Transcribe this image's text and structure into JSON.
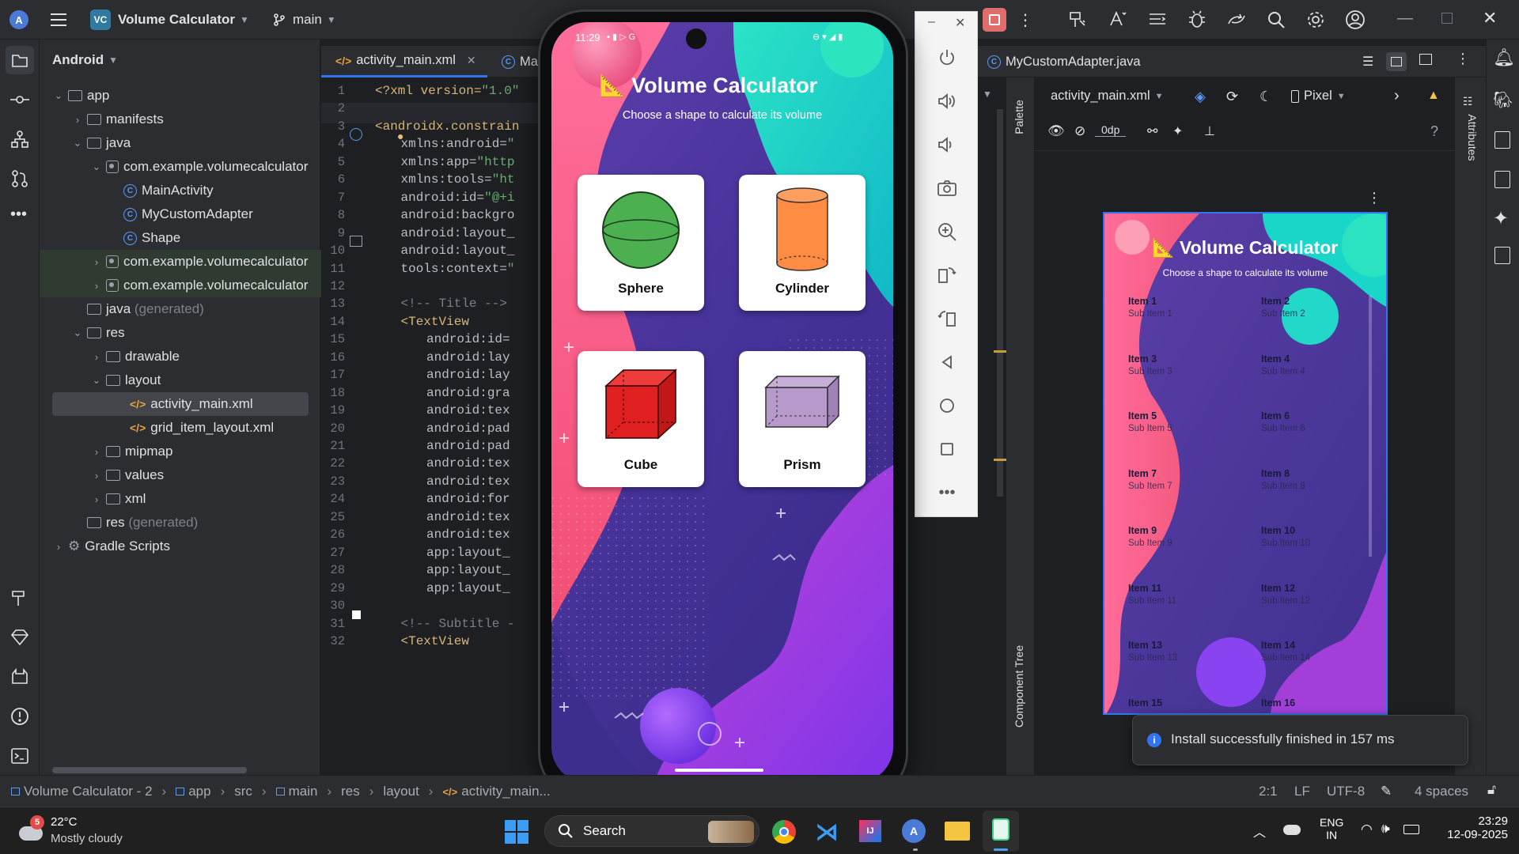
{
  "titlebar": {
    "app_icon_label": "A",
    "project_badge": "VC",
    "project_name": "Volume Calculator",
    "branch": "main"
  },
  "project_panel": {
    "view_selector": "Android",
    "tree": [
      {
        "label": "app"
      },
      {
        "label": "manifests"
      },
      {
        "label": "java"
      },
      {
        "label": "com.example.volumecalculator"
      },
      {
        "label": "MainActivity"
      },
      {
        "label": "MyCustomAdapter"
      },
      {
        "label": "Shape"
      },
      {
        "label": "com.example.volumecalculator"
      },
      {
        "label": "com.example.volumecalculator"
      },
      {
        "label": "java",
        "suffix": "(generated)"
      },
      {
        "label": "res"
      },
      {
        "label": "drawable"
      },
      {
        "label": "layout"
      },
      {
        "label": "activity_main.xml"
      },
      {
        "label": "grid_item_layout.xml"
      },
      {
        "label": "mipmap"
      },
      {
        "label": "values"
      },
      {
        "label": "xml"
      },
      {
        "label": "res",
        "suffix": "(generated)"
      },
      {
        "label": "Gradle Scripts"
      }
    ]
  },
  "editor": {
    "tabs": [
      {
        "label": "activity_main.xml",
        "active": true
      },
      {
        "label": "Ma"
      },
      {
        "label": "MyCustomAdapter.java"
      }
    ],
    "line_numbers": [
      "1",
      "2",
      "3",
      "4",
      "5",
      "6",
      "7",
      "8",
      "9",
      "10",
      "11",
      "12",
      "13",
      "14",
      "15",
      "16",
      "17",
      "18",
      "19",
      "20",
      "21",
      "22",
      "23",
      "24",
      "25",
      "26",
      "27",
      "28",
      "29",
      "30",
      "31",
      "32"
    ],
    "lines": {
      "l1_a": "<?xml version=",
      "l1_b": "\"1.0\"",
      "l3": "<androidx.constrain",
      "l4_a": "xmlns:android=",
      "l4_b": "\"",
      "l5_a": "xmlns:app=",
      "l5_b": "\"http",
      "l6_a": "xmlns:tools=",
      "l6_b": "\"ht",
      "l7_a": "android:id=",
      "l7_b": "\"@+i",
      "l8": "android:backgro",
      "l9": "android:layout_",
      "l10": "android:layout_",
      "l11_a": "tools:context=",
      "l11_b": "\"",
      "l13": "<!-- Title -->",
      "l14": "<TextView",
      "l15": "android:id=",
      "l16": "android:lay",
      "l17": "android:lay",
      "l18": "android:gra",
      "l19": "android:tex",
      "l20": "android:pad",
      "l21": "android:pad",
      "l22": "android:tex",
      "l23": "android:tex",
      "l24": "android:for",
      "l25": "android:tex",
      "l26": "android:tex",
      "l27": "app:layout_",
      "l28": "app:layout_",
      "l29": "app:layout_",
      "l31": "<!-- Subtitle -",
      "l32": "<TextView"
    }
  },
  "phone": {
    "status_time": "11:29",
    "title": "Volume Calculator",
    "subtitle": "Choose a shape to calculate its volume",
    "cards": [
      {
        "label": "Sphere"
      },
      {
        "label": "Cylinder"
      },
      {
        "label": "Cube"
      },
      {
        "label": "Prism"
      }
    ]
  },
  "design": {
    "file_selector": "activity_main.xml",
    "device": "Pixel",
    "margin_value": "0dp",
    "palette_label": "Palette",
    "attributes_label": "Attributes",
    "component_tree_label": "Component Tree",
    "preview_title": "Volume Calculator",
    "preview_subtitle": "Choose a shape to calculate its volume",
    "preview_items": [
      {
        "title": "Item 1",
        "sub": "Sub Item 1"
      },
      {
        "title": "Item 2",
        "sub": "Sub Item 2"
      },
      {
        "title": "Item 3",
        "sub": "Sub Item 3"
      },
      {
        "title": "Item 4",
        "sub": "Sub Item 4"
      },
      {
        "title": "Item 5",
        "sub": "Sub Item 5"
      },
      {
        "title": "Item 6",
        "sub": "Sub Item 6"
      },
      {
        "title": "Item 7",
        "sub": "Sub Item 7"
      },
      {
        "title": "Item 8",
        "sub": "Sub Item 8"
      },
      {
        "title": "Item 9",
        "sub": "Sub Item 9"
      },
      {
        "title": "Item 10",
        "sub": "Sub Item 10"
      },
      {
        "title": "Item 11",
        "sub": "Sub Item 11"
      },
      {
        "title": "Item 12",
        "sub": "Sub Item 12"
      },
      {
        "title": "Item 13",
        "sub": "Sub Item 13"
      },
      {
        "title": "Item 14",
        "sub": "Sub Item 14"
      },
      {
        "title": "Item 15",
        "sub": ""
      },
      {
        "title": "Item 16",
        "sub": ""
      }
    ]
  },
  "toast": {
    "message": "Install successfully finished in 157 ms"
  },
  "statusbar": {
    "breadcrumb": [
      "Volume Calculator - 2",
      "app",
      "src",
      "main",
      "res",
      "layout",
      "activity_main..."
    ],
    "position": "2:1",
    "line_sep": "LF",
    "encoding": "UTF-8",
    "indent": "4 spaces"
  },
  "taskbar": {
    "weather_badge": "5",
    "temperature": "22°C",
    "weather_desc": "Mostly cloudy",
    "search_label": "Search",
    "lang_1": "ENG",
    "lang_2": "IN",
    "time": "23:29",
    "date": "12-09-2025"
  },
  "colors": {
    "ide_bg": "#1e1f22",
    "panel_bg": "#2b2d30",
    "accent": "#3574f0",
    "xml_tag": "#d5b778",
    "xml_string": "#6aab73"
  }
}
